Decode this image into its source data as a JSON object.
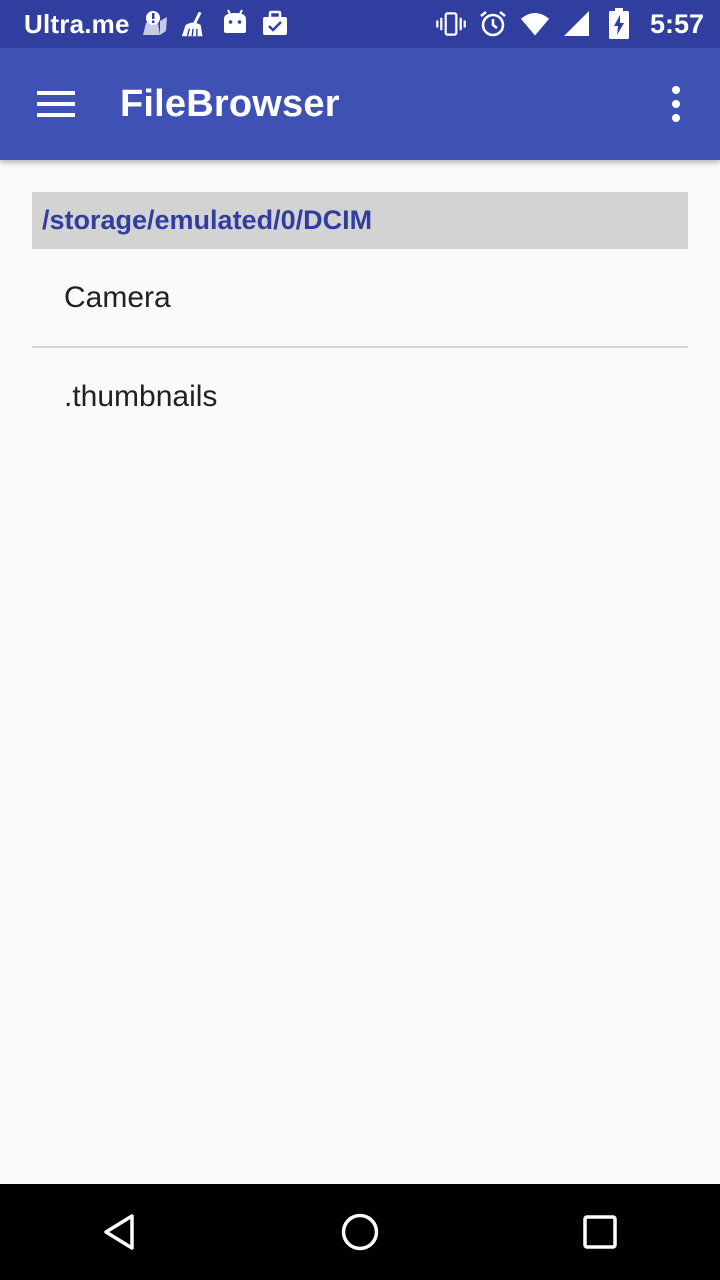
{
  "status_bar": {
    "carrier": "Ultra.me",
    "time": "5:57",
    "left_icons": [
      "alert-app-icon",
      "broom-icon",
      "android-icon",
      "briefcase-check-icon"
    ],
    "right_icons": [
      "vibrate-icon",
      "alarm-icon",
      "wifi-icon",
      "signal-icon",
      "battery-charging-icon"
    ],
    "background_color": "#303f9f"
  },
  "app_bar": {
    "title": "FileBrowser",
    "menu_icon": "hamburger-menu-icon",
    "overflow_icon": "more-vert-icon",
    "background_color": "#3f51b5"
  },
  "browser": {
    "current_path": "/storage/emulated/0/DCIM",
    "path_color": "#303f9f",
    "items": [
      {
        "name": "Camera"
      },
      {
        "name": ".thumbnails"
      }
    ]
  },
  "nav_bar": {
    "buttons": [
      "back-icon",
      "home-icon",
      "recents-icon"
    ]
  }
}
